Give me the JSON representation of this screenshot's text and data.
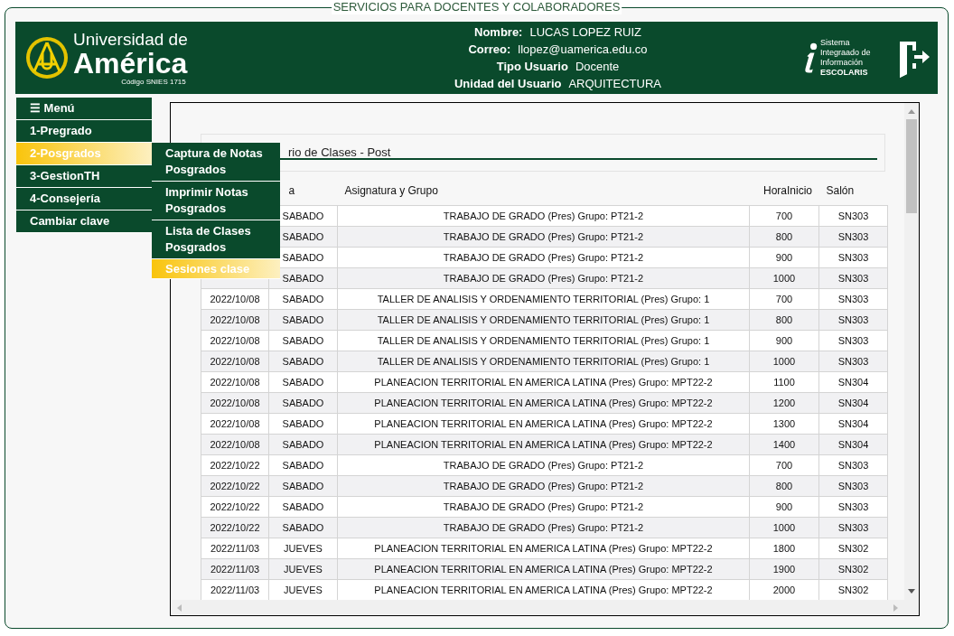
{
  "frame_title": "SERVICIOS PARA DOCENTES Y COLABORADORES",
  "header": {
    "logo": {
      "line1": "Universidad de",
      "line2": "América",
      "code": "Código SNIES 1715"
    },
    "user": [
      {
        "label": "Nombre:",
        "value": "LUCAS LOPEZ RUIZ"
      },
      {
        "label": "Correo:",
        "value": "llopez@uamerica.edu.co"
      },
      {
        "label": "Tipo Usuario",
        "value": "Docente"
      },
      {
        "label": "Unidad del Usuario",
        "value": "ARQUITECTURA"
      }
    ],
    "system": [
      "Sistema",
      "Integraado de",
      "Información",
      "ESCOLARIS"
    ]
  },
  "menu": {
    "title": "☰ Menú",
    "items": [
      {
        "label": "1-Pregrado",
        "selected": false
      },
      {
        "label": "2-Posgrados",
        "selected": true
      },
      {
        "label": "3-GestionTH",
        "selected": false
      },
      {
        "label": "4-Consejería",
        "selected": false
      },
      {
        "label": "Cambiar clave",
        "selected": false
      }
    ],
    "submenu": [
      {
        "label": "Captura de Notas Posgrados",
        "selected": false
      },
      {
        "label": "Imprimir Notas Posgrados",
        "selected": false
      },
      {
        "label": "Lista de Clases Posgrados",
        "selected": false
      },
      {
        "label": "Sesiones clase",
        "selected": true
      }
    ]
  },
  "panel": {
    "title": "rio de Clases - Post",
    "table": {
      "columns": [
        "",
        "a",
        "Asignatura y Grupo",
        "HoraInicio",
        "Salón"
      ],
      "rows": [
        [
          "",
          "SABADO",
          "TRABAJO DE GRADO (Pres) Grupo: PT21-2",
          "700",
          "SN303"
        ],
        [
          "",
          "SABADO",
          "TRABAJO DE GRADO (Pres) Grupo: PT21-2",
          "800",
          "SN303"
        ],
        [
          "",
          "SABADO",
          "TRABAJO DE GRADO (Pres) Grupo: PT21-2",
          "900",
          "SN303"
        ],
        [
          "",
          "SABADO",
          "TRABAJO DE GRADO (Pres) Grupo: PT21-2",
          "1000",
          "SN303"
        ],
        [
          "2022/10/08",
          "SABADO",
          "TALLER DE ANALISIS Y ORDENAMIENTO TERRITORIAL (Pres) Grupo: 1",
          "700",
          "SN303"
        ],
        [
          "2022/10/08",
          "SABADO",
          "TALLER DE ANALISIS Y ORDENAMIENTO TERRITORIAL (Pres) Grupo: 1",
          "800",
          "SN303"
        ],
        [
          "2022/10/08",
          "SABADO",
          "TALLER DE ANALISIS Y ORDENAMIENTO TERRITORIAL (Pres) Grupo: 1",
          "900",
          "SN303"
        ],
        [
          "2022/10/08",
          "SABADO",
          "TALLER DE ANALISIS Y ORDENAMIENTO TERRITORIAL (Pres) Grupo: 1",
          "1000",
          "SN303"
        ],
        [
          "2022/10/08",
          "SABADO",
          "PLANEACION TERRITORIAL EN AMERICA LATINA (Pres) Grupo: MPT22-2",
          "1100",
          "SN304"
        ],
        [
          "2022/10/08",
          "SABADO",
          "PLANEACION TERRITORIAL EN AMERICA LATINA (Pres) Grupo: MPT22-2",
          "1200",
          "SN304"
        ],
        [
          "2022/10/08",
          "SABADO",
          "PLANEACION TERRITORIAL EN AMERICA LATINA (Pres) Grupo: MPT22-2",
          "1300",
          "SN304"
        ],
        [
          "2022/10/08",
          "SABADO",
          "PLANEACION TERRITORIAL EN AMERICA LATINA (Pres) Grupo: MPT22-2",
          "1400",
          "SN304"
        ],
        [
          "2022/10/22",
          "SABADO",
          "TRABAJO DE GRADO (Pres) Grupo: PT21-2",
          "700",
          "SN303"
        ],
        [
          "2022/10/22",
          "SABADO",
          "TRABAJO DE GRADO (Pres) Grupo: PT21-2",
          "800",
          "SN303"
        ],
        [
          "2022/10/22",
          "SABADO",
          "TRABAJO DE GRADO (Pres) Grupo: PT21-2",
          "900",
          "SN303"
        ],
        [
          "2022/10/22",
          "SABADO",
          "TRABAJO DE GRADO (Pres) Grupo: PT21-2",
          "1000",
          "SN303"
        ],
        [
          "2022/11/03",
          "JUEVES",
          "PLANEACION TERRITORIAL EN AMERICA LATINA (Pres) Grupo: MPT22-2",
          "1800",
          "SN302"
        ],
        [
          "2022/11/03",
          "JUEVES",
          "PLANEACION TERRITORIAL EN AMERICA LATINA (Pres) Grupo: MPT22-2",
          "1900",
          "SN302"
        ],
        [
          "2022/11/03",
          "JUEVES",
          "PLANEACION TERRITORIAL EN AMERICA LATINA (Pres) Grupo: MPT22-2",
          "2000",
          "SN302"
        ]
      ]
    }
  }
}
